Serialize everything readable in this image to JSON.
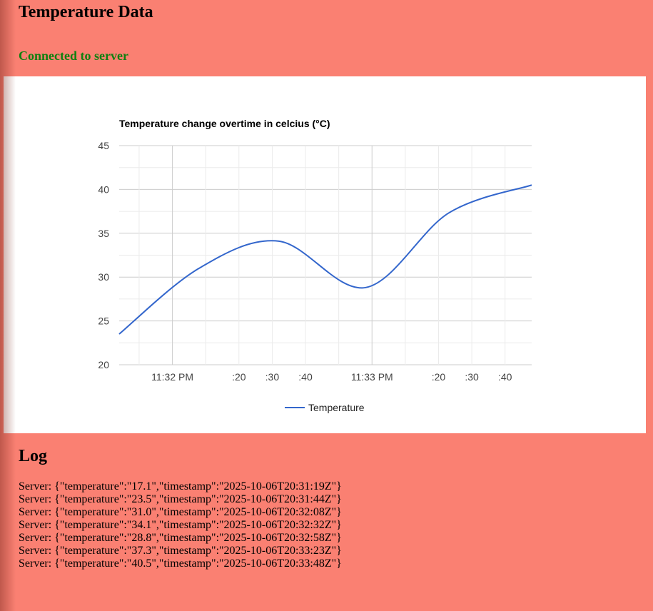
{
  "page": {
    "title": "Temperature Data",
    "status": "Connected to server",
    "status_color": "#108010",
    "background_color": "#fa8072"
  },
  "log": {
    "title": "Log",
    "entries": [
      "Server: {\"temperature\":\"17.1\",\"timestamp\":\"2025-10-06T20:31:19Z\"}",
      "Server: {\"temperature\":\"23.5\",\"timestamp\":\"2025-10-06T20:31:44Z\"}",
      "Server: {\"temperature\":\"31.0\",\"timestamp\":\"2025-10-06T20:32:08Z\"}",
      "Server: {\"temperature\":\"34.1\",\"timestamp\":\"2025-10-06T20:32:32Z\"}",
      "Server: {\"temperature\":\"28.8\",\"timestamp\":\"2025-10-06T20:32:58Z\"}",
      "Server: {\"temperature\":\"37.3\",\"timestamp\":\"2025-10-06T20:33:23Z\"}",
      "Server: {\"temperature\":\"40.5\",\"timestamp\":\"2025-10-06T20:33:48Z\"}"
    ]
  },
  "chart_data": {
    "type": "line",
    "title": "Temperature change overtime in celcius (°C)",
    "xlabel": "",
    "ylabel": "",
    "x": [
      "23:31:44",
      "23:32:08",
      "23:32:32",
      "23:32:58",
      "23:33:23",
      "23:33:48"
    ],
    "series": [
      {
        "name": "Temperature",
        "values": [
          23.5,
          31.0,
          34.1,
          28.8,
          37.3,
          40.5
        ],
        "color": "#3366cc"
      }
    ],
    "xlim": [
      "23:31:44",
      "23:33:48"
    ],
    "ylim": [
      20,
      45
    ],
    "y_ticks": [
      "20",
      "25",
      "30",
      "35",
      "40",
      "45"
    ],
    "x_ticks": [
      {
        "label": "11:32 PM",
        "time": "23:32:00",
        "major": true
      },
      {
        "label": ":20",
        "time": "23:32:20",
        "major": false
      },
      {
        "label": ":30",
        "time": "23:32:30",
        "major": false
      },
      {
        "label": ":40",
        "time": "23:32:40",
        "major": false
      },
      {
        "label": "11:33 PM",
        "time": "23:33:00",
        "major": true
      },
      {
        "label": ":20",
        "time": "23:33:20",
        "major": false
      },
      {
        "label": ":30",
        "time": "23:33:30",
        "major": false
      },
      {
        "label": ":40",
        "time": "23:33:40",
        "major": false
      }
    ],
    "grid": true,
    "legend_position": "bottom"
  }
}
